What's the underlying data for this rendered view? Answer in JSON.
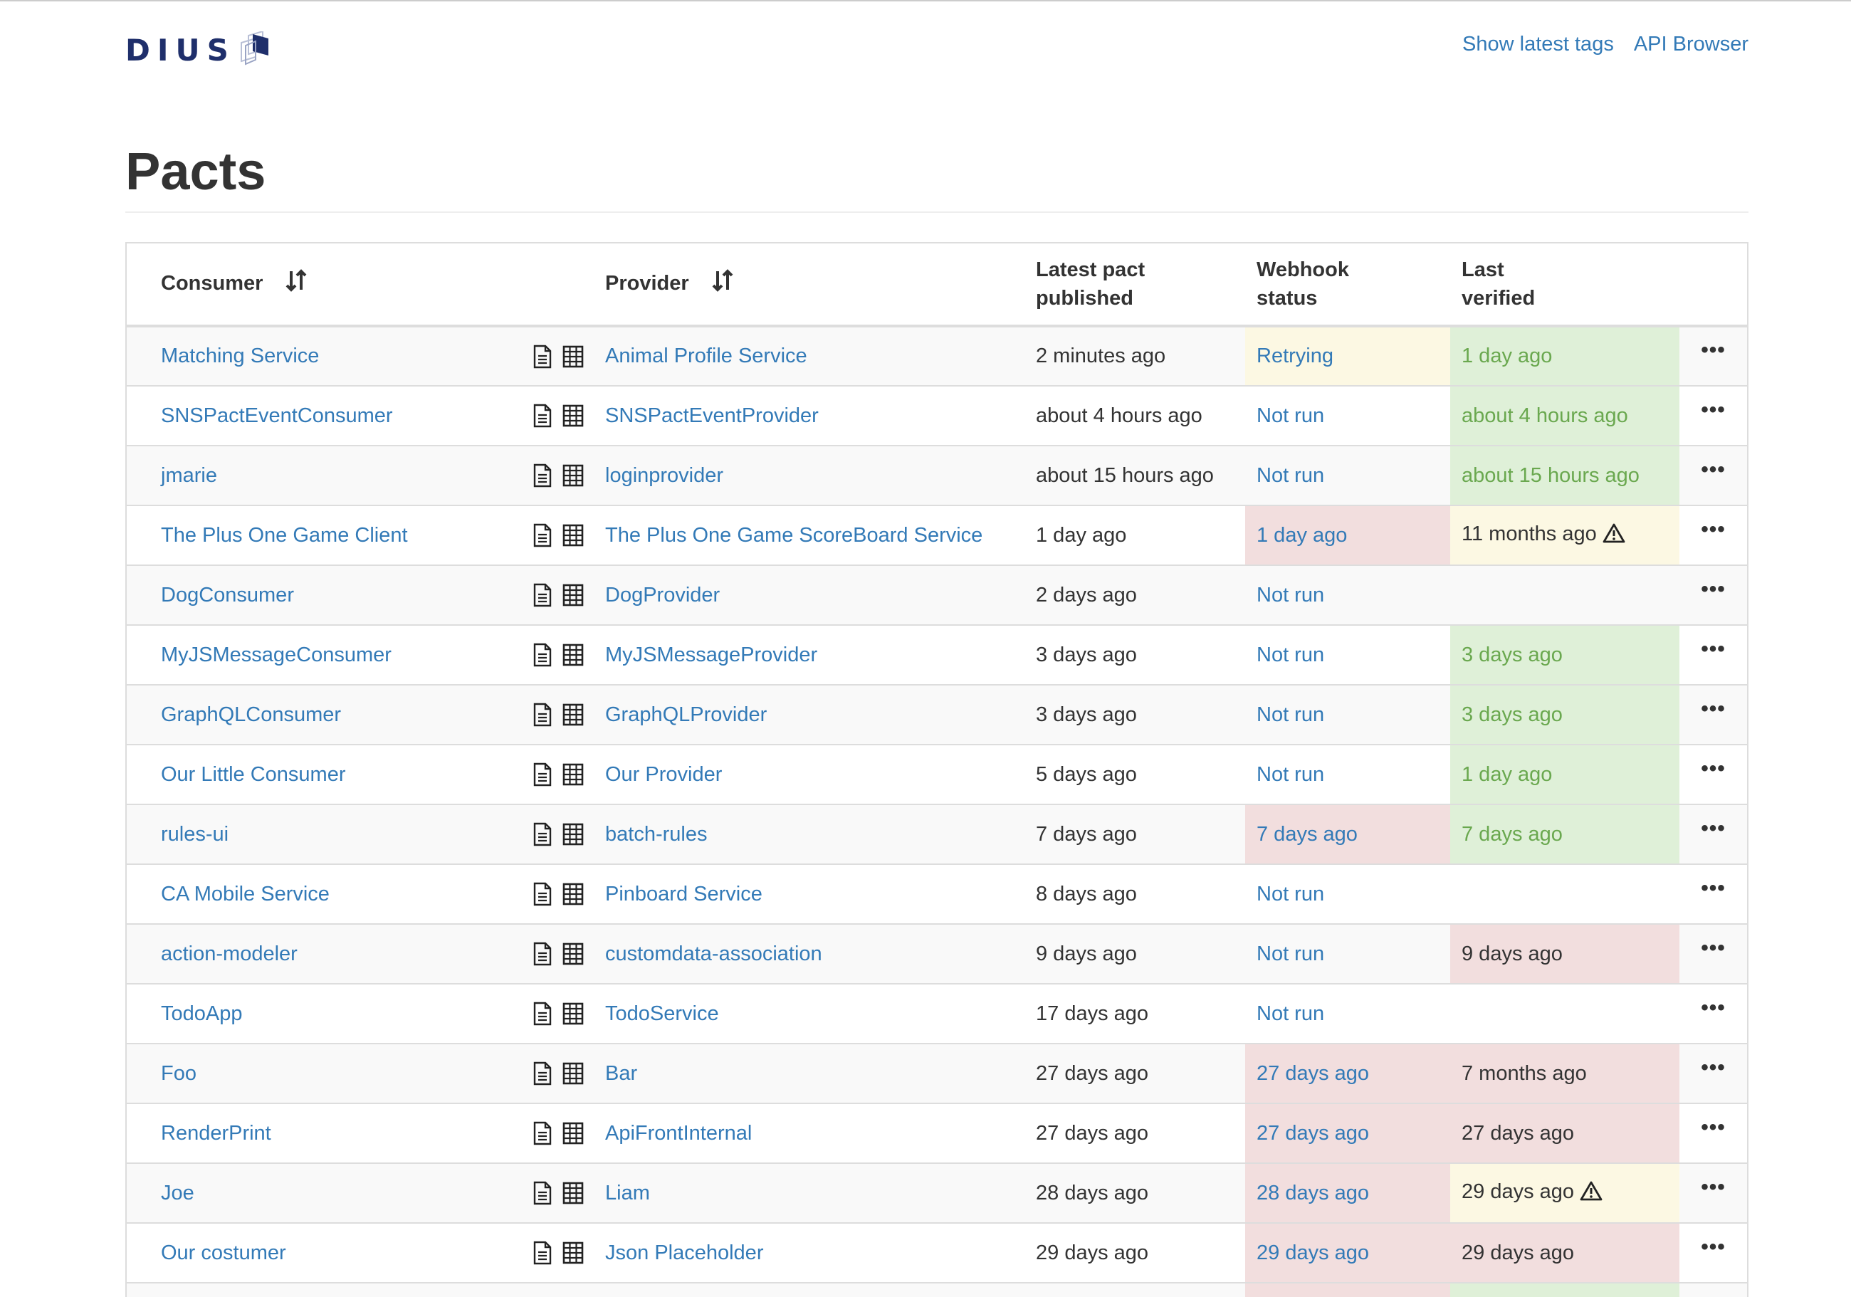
{
  "brand": {
    "logo_text": "DIUS"
  },
  "nav": {
    "latest_tags": "Show latest tags",
    "api_browser": "API Browser"
  },
  "page_title": "Pacts",
  "table": {
    "headers": {
      "consumer": "Consumer",
      "provider": "Provider",
      "published_line1": "Latest pact",
      "published_line2": "published",
      "webhook_line1": "Webhook",
      "webhook_line2": "status",
      "verified_line1": "Last",
      "verified_line2": "verified"
    },
    "rows": [
      {
        "consumer": "Matching Service",
        "provider": "Animal Profile Service",
        "published": "2 minutes ago",
        "webhook": "Retrying",
        "webhook_status": "warning",
        "verified": "1 day ago",
        "verified_status": "success",
        "verified_warning": false
      },
      {
        "consumer": "SNSPactEventConsumer",
        "provider": "SNSPactEventProvider",
        "published": "about 4 hours ago",
        "webhook": "Not run",
        "webhook_status": "none",
        "verified": "about 4 hours ago",
        "verified_status": "success",
        "verified_warning": false
      },
      {
        "consumer": "jmarie",
        "provider": "loginprovider",
        "published": "about 15 hours ago",
        "webhook": "Not run",
        "webhook_status": "none",
        "verified": "about 15 hours ago",
        "verified_status": "success",
        "verified_warning": false
      },
      {
        "consumer": "The Plus One Game Client",
        "provider": "The Plus One Game ScoreBoard Service",
        "published": "1 day ago",
        "webhook": "1 day ago",
        "webhook_status": "danger",
        "verified": "11 months ago",
        "verified_status": "warning",
        "verified_warning": true
      },
      {
        "consumer": "DogConsumer",
        "provider": "DogProvider",
        "published": "2 days ago",
        "webhook": "Not run",
        "webhook_status": "none",
        "verified": "",
        "verified_status": "none",
        "verified_warning": false
      },
      {
        "consumer": "MyJSMessageConsumer",
        "provider": "MyJSMessageProvider",
        "published": "3 days ago",
        "webhook": "Not run",
        "webhook_status": "none",
        "verified": "3 days ago",
        "verified_status": "success",
        "verified_warning": false
      },
      {
        "consumer": "GraphQLConsumer",
        "provider": "GraphQLProvider",
        "published": "3 days ago",
        "webhook": "Not run",
        "webhook_status": "none",
        "verified": "3 days ago",
        "verified_status": "success",
        "verified_warning": false
      },
      {
        "consumer": "Our Little Consumer",
        "provider": "Our Provider",
        "published": "5 days ago",
        "webhook": "Not run",
        "webhook_status": "none",
        "verified": "1 day ago",
        "verified_status": "success",
        "verified_warning": false
      },
      {
        "consumer": "rules-ui",
        "provider": "batch-rules",
        "published": "7 days ago",
        "webhook": "7 days ago",
        "webhook_status": "danger",
        "verified": "7 days ago",
        "verified_status": "success",
        "verified_warning": false
      },
      {
        "consumer": "CA Mobile Service",
        "provider": "Pinboard Service",
        "published": "8 days ago",
        "webhook": "Not run",
        "webhook_status": "none",
        "verified": "",
        "verified_status": "none",
        "verified_warning": false
      },
      {
        "consumer": "action-modeler",
        "provider": "customdata-association",
        "published": "9 days ago",
        "webhook": "Not run",
        "webhook_status": "none",
        "verified": "9 days ago",
        "verified_status": "danger",
        "verified_warning": false
      },
      {
        "consumer": "TodoApp",
        "provider": "TodoService",
        "published": "17 days ago",
        "webhook": "Not run",
        "webhook_status": "none",
        "verified": "",
        "verified_status": "none",
        "verified_warning": false
      },
      {
        "consumer": "Foo",
        "provider": "Bar",
        "published": "27 days ago",
        "webhook": "27 days ago",
        "webhook_status": "danger",
        "verified": "7 months ago",
        "verified_status": "danger",
        "verified_warning": false
      },
      {
        "consumer": "RenderPrint",
        "provider": "ApiFrontInternal",
        "published": "27 days ago",
        "webhook": "27 days ago",
        "webhook_status": "danger",
        "verified": "27 days ago",
        "verified_status": "danger",
        "verified_warning": false
      },
      {
        "consumer": "Joe",
        "provider": "Liam",
        "published": "28 days ago",
        "webhook": "28 days ago",
        "webhook_status": "danger",
        "verified": "29 days ago",
        "verified_status": "warning",
        "verified_warning": true
      },
      {
        "consumer": "Our costumer",
        "provider": "Json Placeholder",
        "published": "29 days ago",
        "webhook": "29 days ago",
        "webhook_status": "danger",
        "verified": "29 days ago",
        "verified_status": "danger",
        "verified_warning": false
      },
      {
        "consumer": "",
        "provider": "",
        "published": "",
        "webhook": "",
        "webhook_status": "danger",
        "verified": "",
        "verified_status": "success",
        "verified_warning": false
      }
    ]
  },
  "colors": {
    "link": "#337ab7",
    "success_bg": "#dff0d8",
    "success_text": "#6aa84f",
    "danger_bg": "#f2dede",
    "warning_bg": "#fcf8e3",
    "logo": "#1f2f6b"
  },
  "icons": {
    "sort": "sort-arrows-icon",
    "pact_doc": "document-icon",
    "matrix": "table-grid-icon",
    "warning": "warning-triangle-icon",
    "menu": "ellipsis-icon"
  }
}
